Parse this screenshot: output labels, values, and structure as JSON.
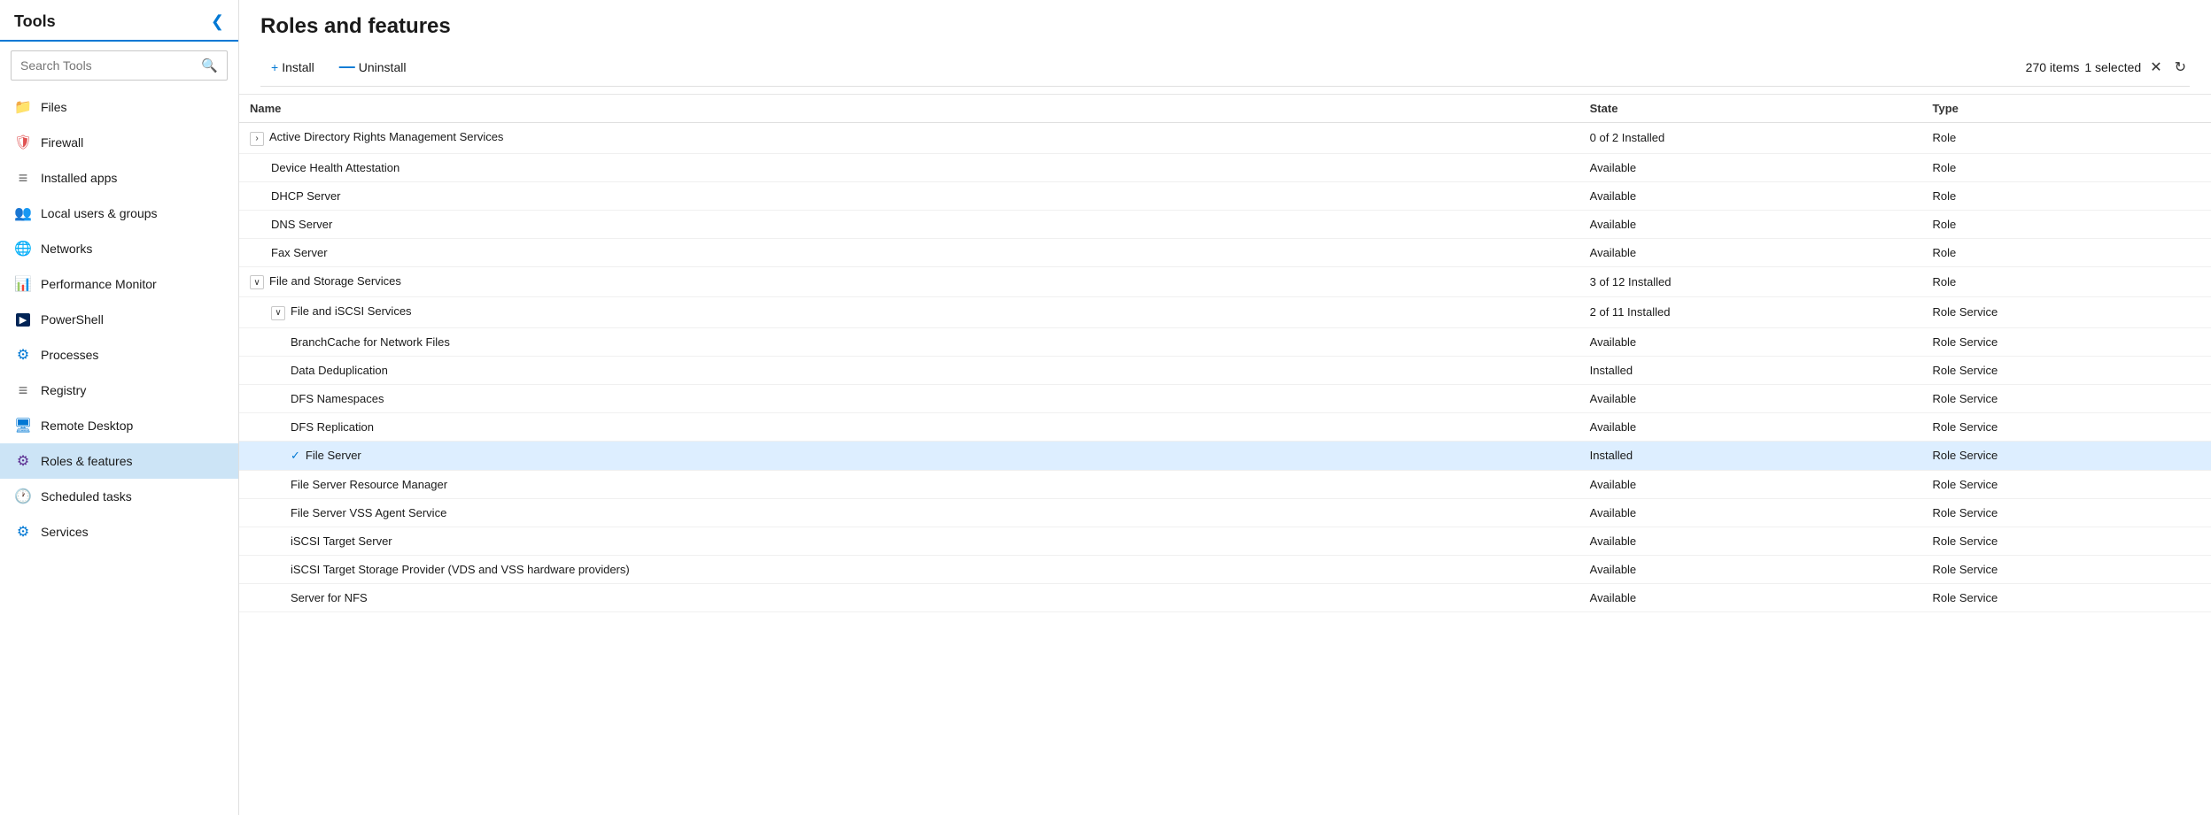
{
  "sidebar": {
    "title": "Tools",
    "search_placeholder": "Search Tools",
    "items": [
      {
        "id": "files",
        "label": "Files",
        "icon": "📁",
        "color": "#f0b429",
        "active": false
      },
      {
        "id": "firewall",
        "label": "Firewall",
        "icon": "🛡",
        "color": "#e05252",
        "active": false
      },
      {
        "id": "installed-apps",
        "label": "Installed apps",
        "icon": "☰",
        "color": "#666",
        "active": false
      },
      {
        "id": "local-users",
        "label": "Local users & groups",
        "icon": "👥",
        "color": "#0078d4",
        "active": false
      },
      {
        "id": "networks",
        "label": "Networks",
        "icon": "🌐",
        "color": "#0078d4",
        "active": false
      },
      {
        "id": "performance-monitor",
        "label": "Performance Monitor",
        "icon": "📊",
        "color": "#0078d4",
        "active": false
      },
      {
        "id": "powershell",
        "label": "PowerShell",
        "icon": "▶",
        "color": "#0078d4",
        "active": false
      },
      {
        "id": "processes",
        "label": "Processes",
        "icon": "⚙",
        "color": "#0078d4",
        "active": false
      },
      {
        "id": "registry",
        "label": "Registry",
        "icon": "☰",
        "color": "#666",
        "active": false
      },
      {
        "id": "remote-desktop",
        "label": "Remote Desktop",
        "icon": "🖥",
        "color": "#0078d4",
        "active": false
      },
      {
        "id": "roles-features",
        "label": "Roles & features",
        "icon": "⚙",
        "color": "#5c2d91",
        "active": true
      },
      {
        "id": "scheduled-tasks",
        "label": "Scheduled tasks",
        "icon": "🕐",
        "color": "#0078d4",
        "active": false
      },
      {
        "id": "services",
        "label": "Services",
        "icon": "⚙",
        "color": "#0078d4",
        "active": false
      }
    ]
  },
  "page": {
    "title": "Roles and features",
    "toolbar": {
      "install_label": "Install",
      "uninstall_label": "Uninstall"
    },
    "status": {
      "item_count": "270 items",
      "selected_count": "1 selected"
    },
    "table": {
      "columns": [
        "Name",
        "State",
        "Type"
      ],
      "rows": [
        {
          "indent": 1,
          "expand": "right",
          "check": false,
          "selected": false,
          "name": "Active Directory Rights Management Services",
          "state": "0 of 2 Installed",
          "type": "Role"
        },
        {
          "indent": 2,
          "expand": "",
          "check": false,
          "selected": false,
          "name": "Device Health Attestation",
          "state": "Available",
          "type": "Role"
        },
        {
          "indent": 2,
          "expand": "",
          "check": false,
          "selected": false,
          "name": "DHCP Server",
          "state": "Available",
          "type": "Role"
        },
        {
          "indent": 2,
          "expand": "",
          "check": false,
          "selected": false,
          "name": "DNS Server",
          "state": "Available",
          "type": "Role"
        },
        {
          "indent": 2,
          "expand": "",
          "check": false,
          "selected": false,
          "name": "Fax Server",
          "state": "Available",
          "type": "Role"
        },
        {
          "indent": 1,
          "expand": "down",
          "check": false,
          "selected": false,
          "name": "File and Storage Services",
          "state": "3 of 12 Installed",
          "type": "Role"
        },
        {
          "indent": 2,
          "expand": "down",
          "check": false,
          "selected": false,
          "name": "File and iSCSI Services",
          "state": "2 of 11 Installed",
          "type": "Role Service"
        },
        {
          "indent": 3,
          "expand": "",
          "check": false,
          "selected": false,
          "name": "BranchCache for Network Files",
          "state": "Available",
          "type": "Role Service"
        },
        {
          "indent": 3,
          "expand": "",
          "check": false,
          "selected": false,
          "name": "Data Deduplication",
          "state": "Installed",
          "type": "Role Service"
        },
        {
          "indent": 3,
          "expand": "",
          "check": false,
          "selected": false,
          "name": "DFS Namespaces",
          "state": "Available",
          "type": "Role Service"
        },
        {
          "indent": 3,
          "expand": "",
          "check": false,
          "selected": false,
          "name": "DFS Replication",
          "state": "Available",
          "type": "Role Service"
        },
        {
          "indent": 3,
          "expand": "",
          "check": true,
          "selected": true,
          "name": "File Server",
          "state": "Installed",
          "type": "Role Service"
        },
        {
          "indent": 3,
          "expand": "",
          "check": false,
          "selected": false,
          "name": "File Server Resource Manager",
          "state": "Available",
          "type": "Role Service"
        },
        {
          "indent": 3,
          "expand": "",
          "check": false,
          "selected": false,
          "name": "File Server VSS Agent Service",
          "state": "Available",
          "type": "Role Service"
        },
        {
          "indent": 3,
          "expand": "",
          "check": false,
          "selected": false,
          "name": "iSCSI Target Server",
          "state": "Available",
          "type": "Role Service"
        },
        {
          "indent": 3,
          "expand": "",
          "check": false,
          "selected": false,
          "name": "iSCSI Target Storage Provider (VDS and VSS hardware providers)",
          "state": "Available",
          "type": "Role Service"
        },
        {
          "indent": 3,
          "expand": "",
          "check": false,
          "selected": false,
          "name": "Server for NFS",
          "state": "Available",
          "type": "Role Service"
        }
      ]
    }
  },
  "icons": {
    "collapse_arrow": "❮",
    "search": "🔍",
    "install_plus": "+",
    "uninstall_dash": "—",
    "close_x": "✕",
    "refresh": "↻",
    "expand_right": "›",
    "expand_down": "∨",
    "checkmark": "✓"
  }
}
